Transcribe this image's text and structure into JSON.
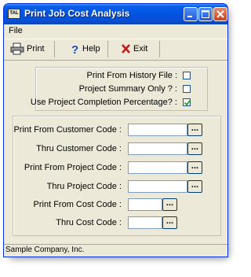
{
  "window": {
    "title": "Print Job Cost Analysis",
    "icon_text": "TAL",
    "controls": [
      "minimize-icon",
      "maximize-icon",
      "close-icon"
    ]
  },
  "menu": {
    "items": [
      {
        "label": "File"
      }
    ]
  },
  "toolbar": {
    "print_label": "Print",
    "help_label": "Help",
    "exit_label": "Exit"
  },
  "options": {
    "items": [
      {
        "label": "Print From History File :",
        "checked": false
      },
      {
        "label": "Project Summary Only ? :",
        "checked": false
      },
      {
        "label": "Use Project Completion Percentage? :",
        "checked": true
      }
    ]
  },
  "fields": [
    {
      "label": "Print From Customer Code :",
      "value": "",
      "lookup": "..."
    },
    {
      "label": "Thru Customer Code :",
      "value": "",
      "lookup": "..."
    },
    {
      "label": "Print From Project Code :",
      "value": "",
      "lookup": "..."
    },
    {
      "label": "Thru Project Code :",
      "value": "",
      "lookup": "..."
    },
    {
      "label": "Print From Cost Code :",
      "value": "",
      "lookup": "..."
    },
    {
      "label": "Thru Cost Code :",
      "value": "",
      "lookup": "..."
    }
  ],
  "status": {
    "text": "Sample Company, Inc."
  },
  "colors": {
    "title_bar": "#0054e3",
    "face": "#ece9d8",
    "close_button": "#c8401c",
    "field_border": "#7f9db9"
  }
}
